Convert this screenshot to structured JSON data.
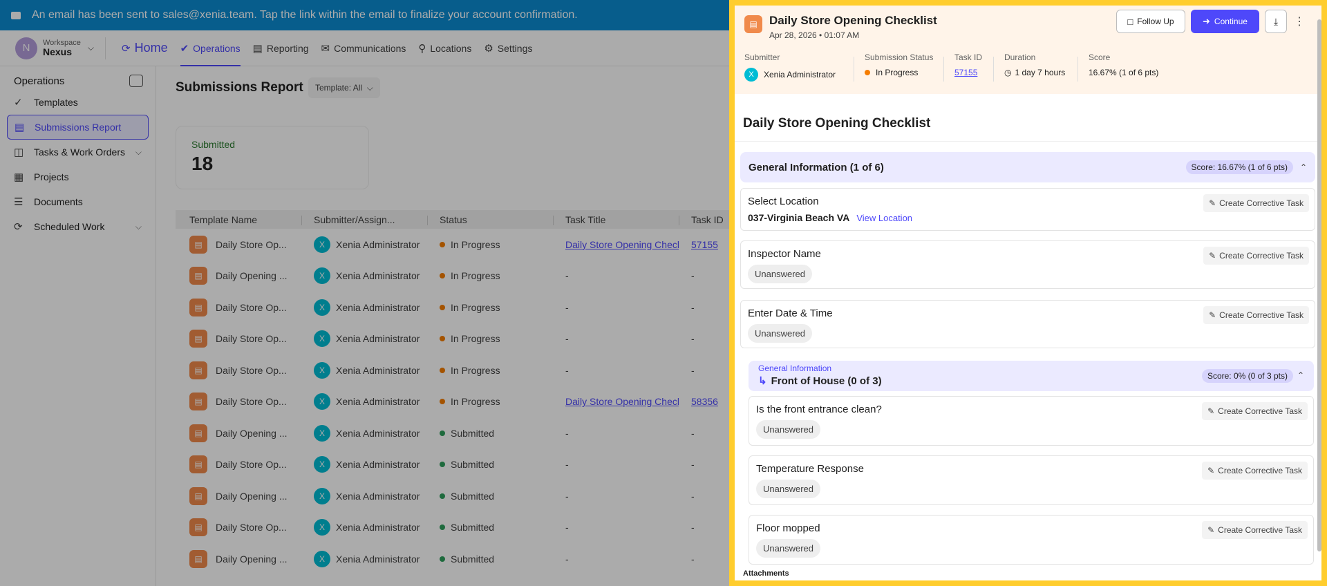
{
  "banner": {
    "text": "An email has been sent to sales@xenia.team. Tap the link within the email to finalize your account confirmation."
  },
  "workspace": {
    "label": "Workspace",
    "name": "Nexus",
    "initial": "N"
  },
  "nav": [
    {
      "label": "Home",
      "icon": "home-icon"
    },
    {
      "label": "Operations",
      "icon": "check-circle-icon"
    },
    {
      "label": "Reporting",
      "icon": "chart-icon"
    },
    {
      "label": "Communications",
      "icon": "chat-icon"
    },
    {
      "label": "Locations",
      "icon": "pin-icon"
    },
    {
      "label": "Settings",
      "icon": "sliders-icon"
    }
  ],
  "sidebar": {
    "title": "Operations",
    "items": [
      {
        "label": "Templates"
      },
      {
        "label": "Submissions Report"
      },
      {
        "label": "Tasks & Work Orders"
      },
      {
        "label": "Projects"
      },
      {
        "label": "Documents"
      },
      {
        "label": "Scheduled Work"
      }
    ]
  },
  "main": {
    "title": "Submissions Report",
    "template_filter": "Template: All",
    "submitted_label": "Submitted",
    "submitted_count": "18",
    "columns": [
      "Template Name",
      "Submitter/Assign...",
      "Status",
      "Task Title",
      "Task ID"
    ],
    "rows": [
      {
        "template": "Daily Store Op...",
        "user": "Xenia Administrator",
        "initial": "X",
        "status": "In Progress",
        "title": "Daily Store Opening Checkl",
        "id": "57155"
      },
      {
        "template": "Daily Opening ...",
        "user": "Xenia Administrator",
        "initial": "X",
        "status": "In Progress",
        "title": "-",
        "id": "-"
      },
      {
        "template": "Daily Store Op...",
        "user": "Xenia Administrator",
        "initial": "X",
        "status": "In Progress",
        "title": "-",
        "id": "-"
      },
      {
        "template": "Daily Store Op...",
        "user": "Xenia Administrator",
        "initial": "X",
        "status": "In Progress",
        "title": "-",
        "id": "-"
      },
      {
        "template": "Daily Store Op...",
        "user": "Xenia Administrator",
        "initial": "X",
        "status": "In Progress",
        "title": "-",
        "id": "-"
      },
      {
        "template": "Daily Store Op...",
        "user": "Xenia Administrator",
        "initial": "X",
        "status": "In Progress",
        "title": "Daily Store Opening Checkl",
        "id": "58356"
      },
      {
        "template": "Daily Opening ...",
        "user": "Xenia Administrator",
        "initial": "X",
        "status": "Submitted",
        "title": "-",
        "id": "-"
      },
      {
        "template": "Daily Store Op...",
        "user": "Xenia Administrator",
        "initial": "X",
        "status": "Submitted",
        "title": "-",
        "id": "-"
      },
      {
        "template": "Daily Opening ...",
        "user": "Xenia Administrator",
        "initial": "X",
        "status": "Submitted",
        "title": "-",
        "id": "-"
      },
      {
        "template": "Daily Store Op...",
        "user": "Xenia Administrator",
        "initial": "X",
        "status": "Submitted",
        "title": "-",
        "id": "-"
      },
      {
        "template": "Daily Opening ...",
        "user": "Xenia Administrator",
        "initial": "X",
        "status": "Submitted",
        "title": "-",
        "id": "-"
      }
    ]
  },
  "status_colors": {
    "In Progress": "#f57c00",
    "Submitted": "#2e9e5b"
  },
  "panel": {
    "title": "Daily Store Opening Checklist",
    "date": "Apr 28, 2026 • 01:07 AM",
    "follow_up": "Follow Up",
    "continue": "Continue",
    "meta": {
      "submitter_label": "Submitter",
      "submitter": "Xenia Administrator",
      "submitter_initial": "X",
      "status_label": "Submission Status",
      "status": "In Progress",
      "taskid_label": "Task ID",
      "taskid": "57155",
      "duration_label": "Duration",
      "duration": "1 day 7 hours",
      "score_label": "Score",
      "score": "16.67% (1 of 6 pts)"
    },
    "checklist_title": "Daily Store Opening Checklist",
    "section": {
      "title": "General Information (1 of 6)",
      "score": "Score: 16.67% (1 of 6 pts)"
    },
    "corrective": "Create Corrective Task",
    "unanswered": "Unanswered",
    "q_location": {
      "title": "Select Location",
      "value": "037-Virginia Beach VA",
      "link": "View Location"
    },
    "q_inspector": {
      "title": "Inspector Name"
    },
    "q_date": {
      "title": "Enter Date & Time"
    },
    "subsection": {
      "parent": "General Information",
      "title": "Front of House (0 of 3)",
      "score": "Score: 0% (0 of 3 pts)"
    },
    "q_entrance": {
      "title": "Is the front entrance clean?"
    },
    "q_temp": {
      "title": "Temperature Response"
    },
    "q_floor": {
      "title": "Floor mopped"
    },
    "attachments": "Attachments"
  }
}
